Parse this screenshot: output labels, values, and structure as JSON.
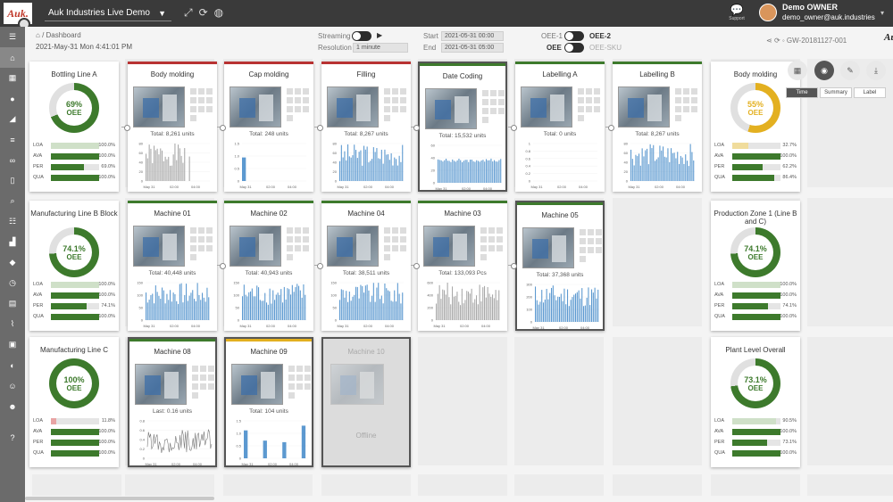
{
  "app": {
    "logo": "Auk.",
    "title": "Auk Industries Live Demo"
  },
  "top_icons": [
    "fullscreen-icon",
    "refresh-icon",
    "globe-icon"
  ],
  "support_label": "Support",
  "user": {
    "name": "Demo OWNER",
    "email": "demo_owner@auk.industries"
  },
  "breadcrumb": "Dashboard",
  "datetime": "2021-May-31 Mon 4:41:01 PM",
  "controls": {
    "streaming": "Streaming",
    "resolution": "Resolution",
    "resolution_value": "1 minute",
    "start": "Start",
    "start_value": "2021-05-31 00:00",
    "end": "End",
    "end_value": "2021-05-31 05:00",
    "oee1": "OEE-1",
    "oee2": "OEE-2",
    "oee": "OEE",
    "oee_sku": "OEE-SKU"
  },
  "gateway": "GW-20181127-001",
  "brand_badge": "Auk.",
  "view_tabs": [
    "Time",
    "Summary",
    "Label"
  ],
  "colors": {
    "green": "#3d7a2c",
    "red": "#b83232",
    "yellow": "#e3b020",
    "blue": "#3f87c8",
    "grey": "#9a9a9a"
  },
  "lines": [
    {
      "title": "Bottling Line A",
      "pct": 69,
      "pct_label": "69%",
      "color": "#3d7a2c",
      "metrics": [
        {
          "k": "LOA",
          "v": "100.0%",
          "f": 1.0,
          "c": "#cfe0c8"
        },
        {
          "k": "AVA",
          "v": "100.0%",
          "f": 1.0,
          "c": "#3d7a2c"
        },
        {
          "k": "PER",
          "v": "69.0%",
          "f": 0.69,
          "c": "#3d7a2c"
        },
        {
          "k": "QUA",
          "v": "100.0%",
          "f": 1.0,
          "c": "#3d7a2c"
        }
      ]
    },
    {
      "title": "Manufacturing Line B Block",
      "pct": 74.1,
      "pct_label": "74.1%",
      "color": "#3d7a2c",
      "metrics": [
        {
          "k": "LOA",
          "v": "100.0%",
          "f": 1.0,
          "c": "#cfe0c8"
        },
        {
          "k": "AVA",
          "v": "100.0%",
          "f": 1.0,
          "c": "#3d7a2c"
        },
        {
          "k": "PER",
          "v": "74.1%",
          "f": 0.741,
          "c": "#3d7a2c"
        },
        {
          "k": "QUA",
          "v": "100.0%",
          "f": 1.0,
          "c": "#3d7a2c"
        }
      ]
    },
    {
      "title": "Manufacturing Line C",
      "pct": 100,
      "pct_label": "100%",
      "color": "#3d7a2c",
      "metrics": [
        {
          "k": "LOA",
          "v": "11.8%",
          "f": 0.118,
          "c": "#e8a4a4"
        },
        {
          "k": "AVA",
          "v": "100.0%",
          "f": 1.0,
          "c": "#3d7a2c"
        },
        {
          "k": "PER",
          "v": "100.0%",
          "f": 1.0,
          "c": "#3d7a2c"
        },
        {
          "k": "QUA",
          "v": "100.0%",
          "f": 1.0,
          "c": "#3d7a2c"
        }
      ]
    },
    {
      "title": "Body molding",
      "pct": 55,
      "pct_label": "55%",
      "color": "#e3b020",
      "metrics": [
        {
          "k": "LOA",
          "v": "32.7%",
          "f": 0.327,
          "c": "#f0dc9c"
        },
        {
          "k": "AVA",
          "v": "100.0%",
          "f": 1.0,
          "c": "#3d7a2c"
        },
        {
          "k": "PER",
          "v": "62.2%",
          "f": 0.622,
          "c": "#3d7a2c"
        },
        {
          "k": "QUA",
          "v": "86.4%",
          "f": 0.864,
          "c": "#3d7a2c"
        }
      ]
    },
    {
      "title": "Production Zone 1 (Line B and C)",
      "pct": 74.1,
      "pct_label": "74.1%",
      "color": "#3d7a2c",
      "metrics": [
        {
          "k": "LOA",
          "v": "100.0%",
          "f": 1.0,
          "c": "#cfe0c8"
        },
        {
          "k": "AVA",
          "v": "100.0%",
          "f": 1.0,
          "c": "#3d7a2c"
        },
        {
          "k": "PER",
          "v": "74.1%",
          "f": 0.741,
          "c": "#3d7a2c"
        },
        {
          "k": "QUA",
          "v": "100.0%",
          "f": 1.0,
          "c": "#3d7a2c"
        }
      ]
    },
    {
      "title": "Plant Level Overall",
      "pct": 73.1,
      "pct_label": "73.1%",
      "color": "#3d7a2c",
      "metrics": [
        {
          "k": "LOA",
          "v": "90.5%",
          "f": 0.905,
          "c": "#cfe0c8"
        },
        {
          "k": "AVA",
          "v": "100.0%",
          "f": 1.0,
          "c": "#3d7a2c"
        },
        {
          "k": "PER",
          "v": "73.1%",
          "f": 0.731,
          "c": "#3d7a2c"
        },
        {
          "k": "QUA",
          "v": "100.0%",
          "f": 1.0,
          "c": "#3d7a2c"
        }
      ]
    }
  ],
  "oee_label": "OEE",
  "machines": [
    {
      "title": "Body molding",
      "status": "#b83232",
      "total": "Total: 8,261 units",
      "yticks": [
        "80",
        "60",
        "40",
        "20",
        "0"
      ],
      "style": "grey",
      "seed": 1
    },
    {
      "title": "Cap molding",
      "status": "#b83232",
      "total": "Total: 248 units",
      "yticks": [
        "1.5",
        "1.0",
        "0.5",
        "0"
      ],
      "style": "blue",
      "seed": 2
    },
    {
      "title": "Filling",
      "status": "#b83232",
      "total": "Total: 8,267 units",
      "yticks": [
        "80",
        "60",
        "40",
        "20",
        "0"
      ],
      "style": "blue",
      "seed": 3
    },
    {
      "title": "Date Coding",
      "status": "#3d7a2c",
      "total": "Total: 15,532 units",
      "yticks": [
        "60",
        "40",
        "20",
        "0"
      ],
      "style": "blue",
      "seed": 4
    },
    {
      "title": "Labelling A",
      "status": "#3d7a2c",
      "total": "Total: 0 units",
      "yticks": [
        "1",
        "0.8",
        "0.6",
        "0.4",
        "0.2",
        "0"
      ],
      "style": "empty",
      "seed": 5
    },
    {
      "title": "Labelling B",
      "status": "#3d7a2c",
      "total": "Total: 8,267 units",
      "yticks": [
        "80",
        "60",
        "40",
        "20",
        "0"
      ],
      "style": "blue",
      "seed": 6
    },
    {
      "title": "Machine 01",
      "status": "#3d7a2c",
      "total": "Total: 40,448 units",
      "yticks": [
        "150",
        "100",
        "50",
        "0"
      ],
      "style": "blue",
      "seed": 7
    },
    {
      "title": "Machine 02",
      "status": "#3d7a2c",
      "total": "Total: 40,943 units",
      "yticks": [
        "150",
        "100",
        "50",
        "0"
      ],
      "style": "blue",
      "seed": 8
    },
    {
      "title": "Machine 04",
      "status": "#3d7a2c",
      "total": "Total: 38,511 units",
      "yticks": [
        "150",
        "100",
        "50",
        "0"
      ],
      "style": "blue",
      "seed": 9
    },
    {
      "title": "Machine 03",
      "status": "#3d7a2c",
      "total": "Total: 133,093 Pcs",
      "yticks": [
        "600",
        "400",
        "200",
        "0"
      ],
      "style": "grey",
      "seed": 10
    },
    {
      "title": "Machine 05",
      "status": "#3d7a2c",
      "total": "Total: 37,368 units",
      "yticks": [
        "300",
        "200",
        "100",
        "0"
      ],
      "style": "blue",
      "seed": 11
    },
    {
      "title": "Machine 08",
      "status": "#3d7a2c",
      "total": "Last: 0.16 units",
      "yticks": [
        "0.8",
        "0.6",
        "0.4",
        "0.2",
        "0"
      ],
      "style": "line",
      "seed": 12
    },
    {
      "title": "Machine 09",
      "status": "#e3b020",
      "total": "Total: 104 units",
      "yticks": [
        "1.5",
        "1.0",
        "0.5",
        "0"
      ],
      "style": "blue",
      "seed": 13
    },
    {
      "title": "Machine 10",
      "status": "",
      "total": "",
      "yticks": [],
      "style": "offline",
      "seed": 14,
      "offline": "Offline"
    }
  ],
  "xticks": [
    "May 31",
    "02:00",
    "04:00"
  ]
}
